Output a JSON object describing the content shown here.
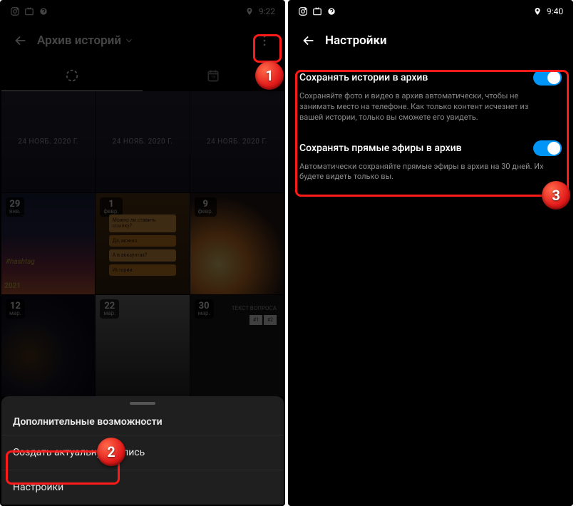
{
  "left": {
    "status": {
      "time": "9:22"
    },
    "header": {
      "title": "Архив историй"
    },
    "row1": [
      {
        "label": "24 НОЯБ. 2020 Г."
      },
      {
        "label": "24 НОЯБ. 2020 Г."
      },
      {
        "label": "24 НОЯБ. 2020 Г."
      }
    ],
    "row2": [
      {
        "day": "29",
        "month": "янв."
      },
      {
        "day": "1",
        "month": "февр."
      },
      {
        "day": "9",
        "month": "февр."
      }
    ],
    "row3": [
      {
        "day": "12",
        "month": "мар."
      },
      {
        "day": "22",
        "month": "мар."
      },
      {
        "day": "30",
        "month": "мар."
      }
    ],
    "hashtag": "#hashtag",
    "year": "2021",
    "msgs": [
      "Можно ли ставить ссылку?",
      "Да, можно.",
      "А в аккаунтах?",
      "Истории."
    ],
    "qlabel": "ТЕКСТ ВОПРОСА",
    "qa": "#1",
    "qb": "#2",
    "sheet": {
      "title": "Дополнительные возможности",
      "item1": "Создать актуальную запись",
      "item2": "Настройки"
    }
  },
  "right": {
    "status": {
      "time": "9:40"
    },
    "header": {
      "title": "Настройки"
    },
    "s1": {
      "title": "Сохранять истории в архив",
      "desc": "Сохраняйте фото и видео в архив автоматически, чтобы не занимать место на телефоне. Как только контент исчезнет из вашей истории, только вы сможете его увидеть."
    },
    "s2": {
      "title": "Сохранять прямые эфиры в архив",
      "desc": "Автоматически сохраняйте прямые эфиры в архив на 30 дней. Их будете видеть только вы."
    }
  },
  "badges": {
    "b1": "1",
    "b2": "2",
    "b3": "3"
  }
}
